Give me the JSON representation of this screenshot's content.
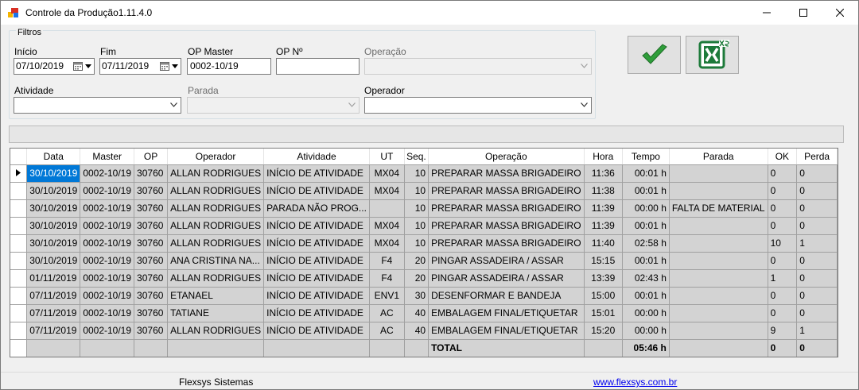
{
  "window": {
    "title": "Controle da Produção1.11.4.0"
  },
  "filters": {
    "group_label": "Filtros",
    "inicio_label": "Início",
    "inicio_value": "07/10/2019",
    "fim_label": "Fim",
    "fim_value": "07/11/2019",
    "op_master_label": "OP Master",
    "op_master_value": "0002-10/19",
    "op_no_label": "OP Nº",
    "op_no_value": "",
    "operacao_label": "Operação",
    "operacao_value": "",
    "atividade_label": "Atividade",
    "atividade_value": "",
    "parada_label": "Parada",
    "parada_value": "",
    "operador_label": "Operador",
    "operador_value": ""
  },
  "toolbar": {
    "confirm_icon": "checkmark-icon",
    "excel_icon": "excel-export-icon"
  },
  "grid": {
    "columns": [
      "Data",
      "Master",
      "OP",
      "Operador",
      "Atividade",
      "UT",
      "Seq.",
      "Operação",
      "Hora",
      "Tempo",
      "Parada",
      "OK",
      "Perda"
    ],
    "rows": [
      [
        "30/10/2019",
        "0002-10/19",
        "30760",
        "ALLAN RODRIGUES",
        "INÍCIO DE ATIVIDADE",
        "MX04",
        "10",
        "PREPARAR MASSA BRIGADEIRO",
        "11:36",
        "00:01 h",
        "",
        "0",
        "0"
      ],
      [
        "30/10/2019",
        "0002-10/19",
        "30760",
        "ALLAN RODRIGUES",
        "INÍCIO DE ATIVIDADE",
        "MX04",
        "10",
        "PREPARAR MASSA BRIGADEIRO",
        "11:38",
        "00:01 h",
        "",
        "0",
        "0"
      ],
      [
        "30/10/2019",
        "0002-10/19",
        "30760",
        "ALLAN RODRIGUES",
        "PARADA NÃO PROG...",
        "",
        "10",
        "PREPARAR MASSA BRIGADEIRO",
        "11:39",
        "00:00 h",
        "FALTA DE MATERIAL",
        "0",
        "0"
      ],
      [
        "30/10/2019",
        "0002-10/19",
        "30760",
        "ALLAN RODRIGUES",
        "INÍCIO DE ATIVIDADE",
        "MX04",
        "10",
        "PREPARAR MASSA BRIGADEIRO",
        "11:39",
        "00:01 h",
        "",
        "0",
        "0"
      ],
      [
        "30/10/2019",
        "0002-10/19",
        "30760",
        "ALLAN RODRIGUES",
        "INÍCIO DE ATIVIDADE",
        "MX04",
        "10",
        "PREPARAR MASSA BRIGADEIRO",
        "11:40",
        "02:58 h",
        "",
        "10",
        "1"
      ],
      [
        "30/10/2019",
        "0002-10/19",
        "30760",
        "ANA CRISTINA NA...",
        "INÍCIO DE ATIVIDADE",
        "F4",
        "20",
        "PINGAR ASSADEIRA / ASSAR",
        "15:15",
        "00:01 h",
        "",
        "0",
        "0"
      ],
      [
        "01/11/2019",
        "0002-10/19",
        "30760",
        "ALLAN RODRIGUES",
        "INÍCIO DE ATIVIDADE",
        "F4",
        "20",
        "PINGAR ASSADEIRA / ASSAR",
        "13:39",
        "02:43 h",
        "",
        "1",
        "0"
      ],
      [
        "07/11/2019",
        "0002-10/19",
        "30760",
        "ETANAEL",
        "INÍCIO DE ATIVIDADE",
        "ENV1",
        "30",
        "DESENFORMAR E BANDEJA",
        "15:00",
        "00:01 h",
        "",
        "0",
        "0"
      ],
      [
        "07/11/2019",
        "0002-10/19",
        "30760",
        "TATIANE",
        "INÍCIO DE ATIVIDADE",
        "AC",
        "40",
        "EMBALAGEM FINAL/ETIQUETAR",
        "15:01",
        "00:00 h",
        "",
        "0",
        "0"
      ],
      [
        "07/11/2019",
        "0002-10/19",
        "30760",
        "ALLAN RODRIGUES",
        "INÍCIO DE ATIVIDADE",
        "AC",
        "40",
        "EMBALAGEM FINAL/ETIQUETAR",
        "15:20",
        "00:00 h",
        "",
        "9",
        "1"
      ]
    ],
    "total": {
      "label": "TOTAL",
      "tempo": "05:46 h",
      "ok": "0",
      "perda": "0"
    }
  },
  "status_bar": {
    "company": "Flexsys Sistemas",
    "website": "www.flexsys.com.br"
  },
  "colors": {
    "selection": "#0078d7",
    "check_green": "#2f9e3a",
    "excel_green": "#1d7a3a"
  }
}
